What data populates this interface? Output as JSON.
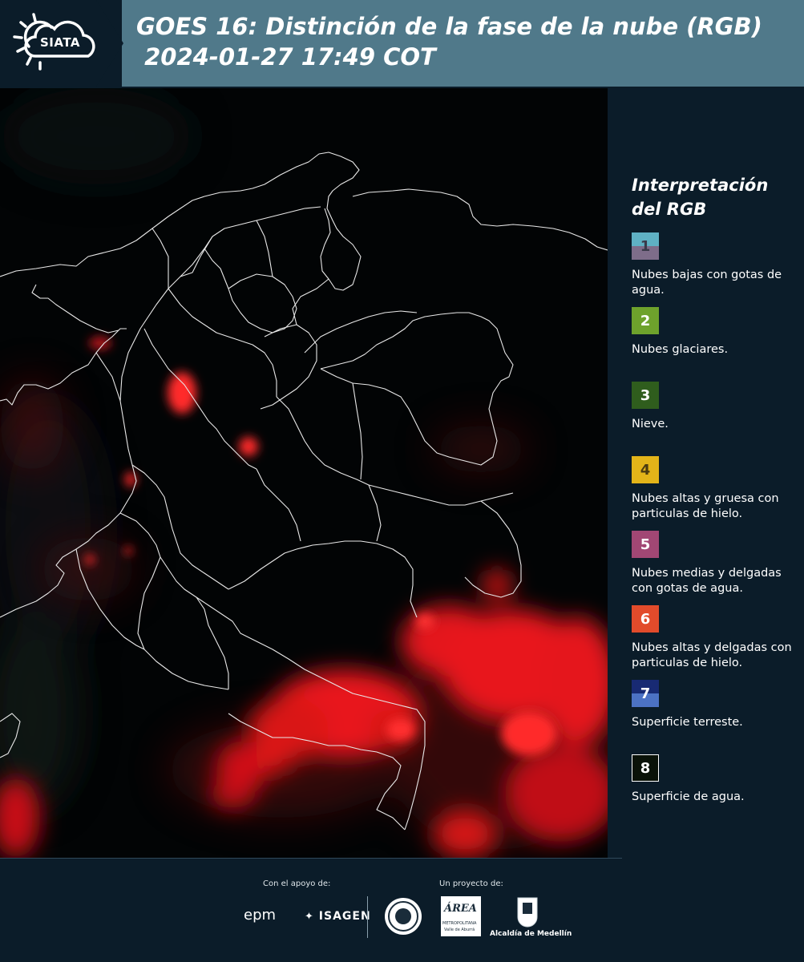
{
  "header": {
    "logo_text": "SIATA",
    "title_line1": "GOES 16: Distinción de la fase de la nube (RGB)",
    "title_line2": " 2024-01-27 17:49 COT"
  },
  "legend": {
    "title_line1": "Interpretación",
    "title_line2": "del RGB",
    "items": [
      {
        "number": "1",
        "label": "Nubes bajas con gotas de agua.",
        "color_top": "#5fb1c4",
        "color_bottom": "#7e6d8a",
        "text_color": "#3a3a4a"
      },
      {
        "number": "2",
        "label": "Nubes glaciares.",
        "color": "#6ea22c",
        "text_color": "#ffffff"
      },
      {
        "number": "3",
        "label": "Nieve.",
        "color": "#2f5d1d",
        "text_color": "#ffffff"
      },
      {
        "number": "4",
        "label": "Nubes altas y gruesa con particulas de hielo.",
        "color": "#e3b419",
        "text_color": "#4a3a10"
      },
      {
        "number": "5",
        "label": "Nubes medias y delgadas con gotas de agua.",
        "color": "#a14774",
        "text_color": "#ffffff"
      },
      {
        "number": "6",
        "label": "Nubes altas y delgadas con particulas de hielo.",
        "color": "#e24b2b",
        "text_color": "#ffffff"
      },
      {
        "number": "7",
        "label": "Superficie terreste.",
        "color_top": "#182a73",
        "color_bottom": "#4c72c4",
        "text_color": "#ffffff"
      },
      {
        "number": "8",
        "label": "Superficie de agua.",
        "color": "#0a1208",
        "border": "#ffffff",
        "text_color": "#ffffff"
      }
    ]
  },
  "footer": {
    "support_label": "Con el apoyo de:",
    "project_label": "Un proyecto de:",
    "sponsor1": "epm",
    "sponsor2": "ISAGEN",
    "partner1_line1": "ÁREA",
    "partner1_line2": "METROPOLITANA",
    "partner1_line3": "Valle de Aburrá",
    "partner2": "Alcaldía de Medellín"
  }
}
